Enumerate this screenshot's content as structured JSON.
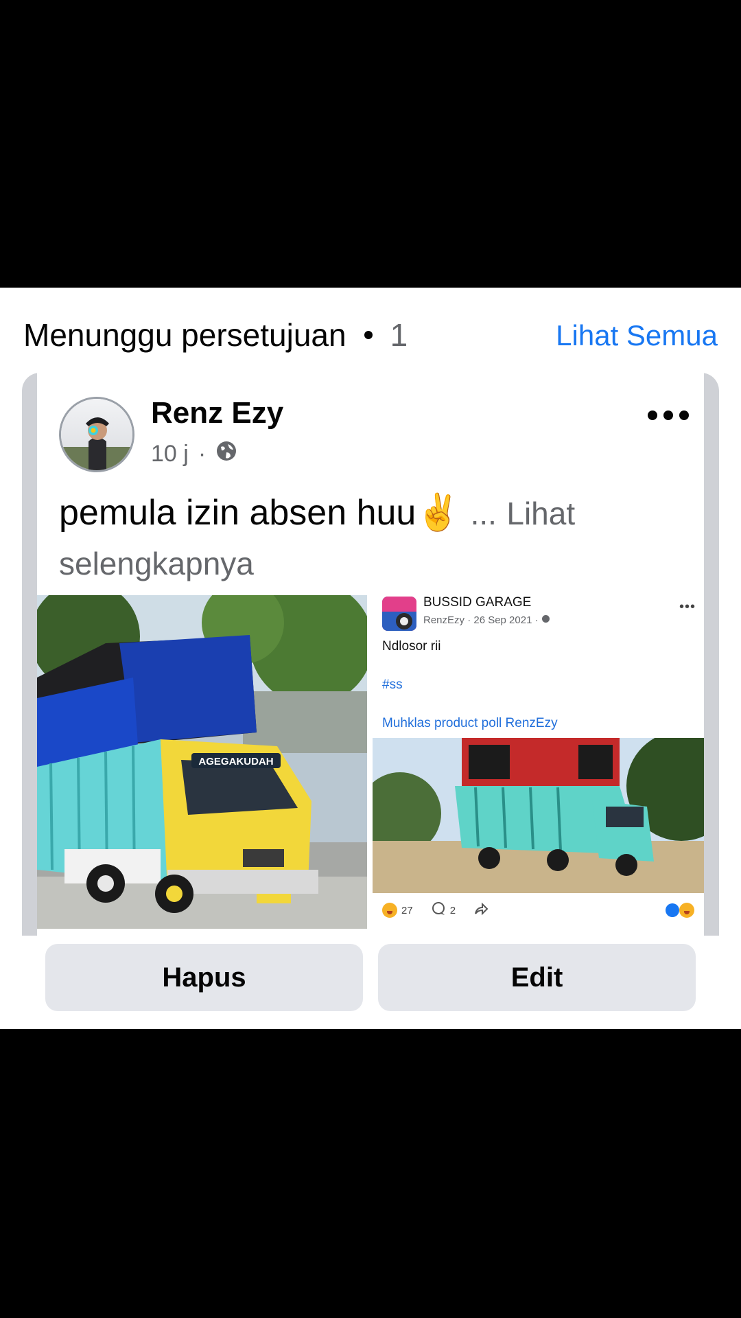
{
  "section": {
    "title": "Menunggu persetujuan",
    "count": "1",
    "see_all": "Lihat Semua"
  },
  "post": {
    "author": "Renz Ezy",
    "time": "10 j",
    "text": "pemula izin absen huu",
    "emoji": "✌️",
    "ellipsis": "...",
    "see_more": "Lihat selengkapnya",
    "shared": {
      "page_name": "BUSSID GARAGE",
      "meta": "RenzEzy · 26 Sep 2021 ·",
      "text": "Ndlosor rii",
      "hashtag": "#ss",
      "caption": "Muhklas product poll RenzEzy",
      "reactions_count": "27",
      "comments_count": "2",
      "dots": "•••"
    }
  },
  "actions": {
    "delete_label": "Hapus",
    "edit_label": "Edit"
  },
  "colors": {
    "link": "#1877f2",
    "secondary_text": "#65676b",
    "button_bg": "#e4e6eb"
  }
}
